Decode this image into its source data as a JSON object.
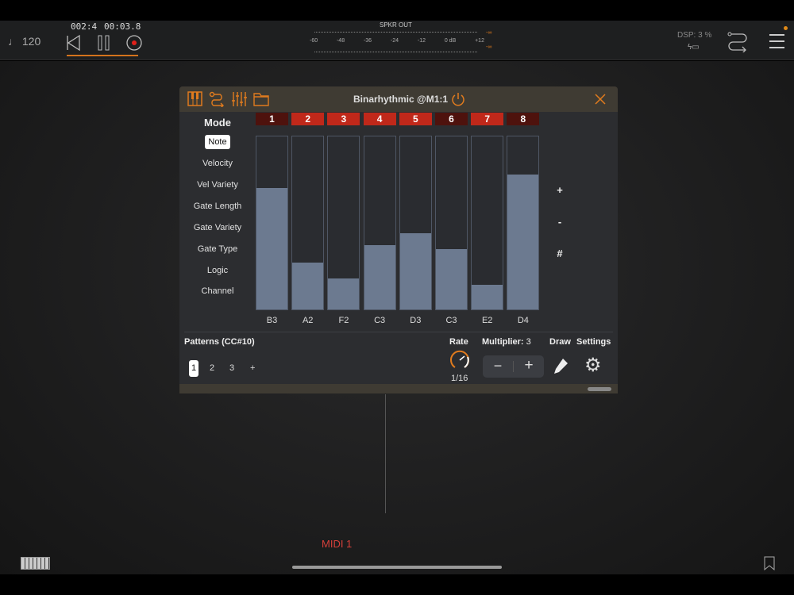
{
  "transport": {
    "tempo": "120",
    "position": "002:4",
    "time": "00:03.8"
  },
  "meter": {
    "title": "SPKR OUT",
    "ticks": [
      "-60",
      "-48",
      "-36",
      "-24",
      "-12",
      "0 dB",
      "+12"
    ],
    "peak_l": "-∞",
    "peak_r": "-∞"
  },
  "status": {
    "dsp": "DSP:  3 %"
  },
  "plugin": {
    "title": "Binarhythmic @M1:1",
    "mode_label": "Mode",
    "modes": [
      "Note",
      "Velocity",
      "Vel Variety",
      "Gate Length",
      "Gate Variety",
      "Gate Type",
      "Logic",
      "Channel"
    ],
    "steps": [
      {
        "n": "1",
        "on": false,
        "value": 0.7,
        "note": "B3"
      },
      {
        "n": "2",
        "on": true,
        "value": 0.27,
        "note": "A2"
      },
      {
        "n": "3",
        "on": true,
        "value": 0.18,
        "note": "F2"
      },
      {
        "n": "4",
        "on": true,
        "value": 0.37,
        "note": "C3"
      },
      {
        "n": "5",
        "on": true,
        "value": 0.44,
        "note": "D3"
      },
      {
        "n": "6",
        "on": false,
        "value": 0.35,
        "note": "C3"
      },
      {
        "n": "7",
        "on": true,
        "value": 0.14,
        "note": "E2"
      },
      {
        "n": "8",
        "on": false,
        "value": 0.78,
        "note": "D4"
      }
    ],
    "side_buttons": [
      "+",
      "-",
      "#"
    ],
    "patterns_label": "Patterns (CC#10)",
    "patterns": [
      "1",
      "2",
      "3",
      "+"
    ],
    "rate_label": "Rate",
    "rate_value": "1/16",
    "multiplier_label": "Multiplier:",
    "multiplier_value": "3",
    "minus": "−",
    "plus": "+",
    "draw_label": "Draw",
    "settings_label": "Settings"
  },
  "canvas": {
    "node_label": "MIDI 1"
  },
  "colors": {
    "accent": "#e07b1e",
    "step_on": "#c0281a",
    "step_off": "#4e120d",
    "bar": "#6c7a90"
  }
}
